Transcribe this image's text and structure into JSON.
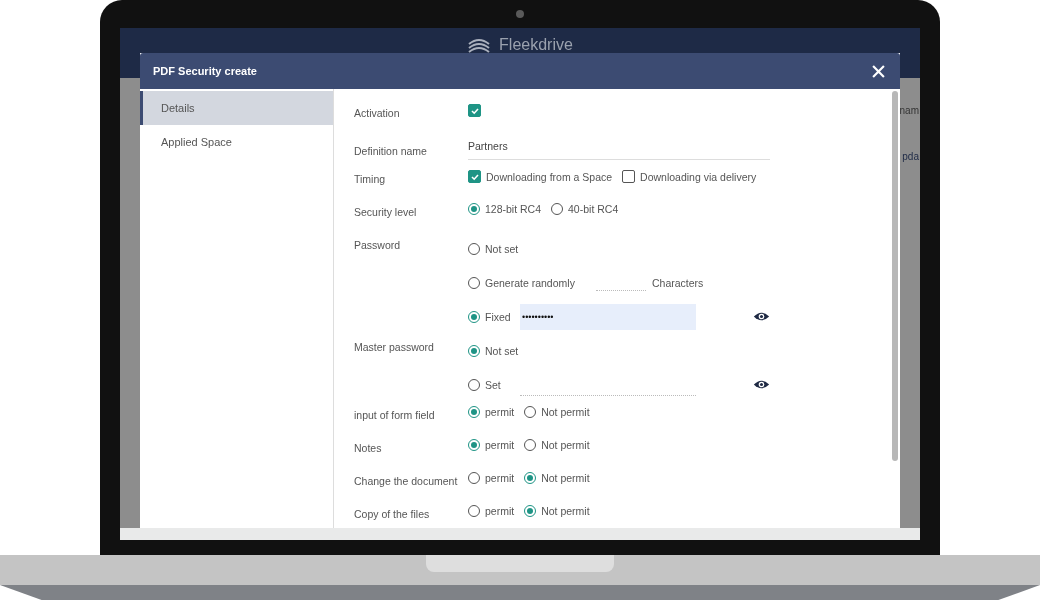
{
  "app": {
    "logo": "Fleekdrive",
    "background_fragments": [
      "nam",
      "pda"
    ]
  },
  "dialog": {
    "title": "PDF Security create",
    "tabs": [
      {
        "label": "Details",
        "selected": true
      },
      {
        "label": "Applied Space",
        "selected": false
      }
    ],
    "fields": [
      {
        "label": "Activation",
        "kind": "checkbox",
        "checked": true
      },
      {
        "label": "Definition name",
        "kind": "text",
        "value": "Partners"
      },
      {
        "label": "Timing",
        "kind": "checkboxes",
        "options": [
          {
            "label": "Downloading from a Space",
            "checked": true
          },
          {
            "label": "Downloading via delivery",
            "checked": false
          }
        ]
      },
      {
        "label": "Security level",
        "kind": "radios",
        "options": [
          {
            "label": "128-bit RC4",
            "selected": true
          },
          {
            "label": "40-bit RC4",
            "selected": false
          }
        ]
      },
      {
        "label": "Password",
        "kind": "stack",
        "options": [
          {
            "label": "Not set",
            "selected": false
          },
          {
            "label": "Generate randomly",
            "selected": false,
            "kind": "short_field",
            "suffix": "Characters"
          },
          {
            "label": "Fixed",
            "selected": true,
            "kind": "long_field",
            "value": "••••••••••",
            "reveal": true
          }
        ]
      },
      {
        "label": "Master password",
        "kind": "stack",
        "options": [
          {
            "label": "Not set",
            "selected": true
          },
          {
            "label": "Set",
            "selected": false,
            "kind": "long_field",
            "reveal": true
          }
        ]
      },
      {
        "label": "input of form field",
        "kind": "radios",
        "options": [
          {
            "label": "permit",
            "selected": true
          },
          {
            "label": "Not permit",
            "selected": false
          }
        ]
      },
      {
        "label": "Notes",
        "kind": "radios",
        "options": [
          {
            "label": "permit",
            "selected": true
          },
          {
            "label": "Not permit",
            "selected": false
          }
        ]
      },
      {
        "label": "Change the document",
        "kind": "radios",
        "options": [
          {
            "label": "permit",
            "selected": false
          },
          {
            "label": "Not permit",
            "selected": true
          }
        ]
      },
      {
        "label": "Copy of the files",
        "kind": "radios",
        "options": [
          {
            "label": "permit",
            "selected": false
          },
          {
            "label": "Not permit",
            "selected": true
          }
        ]
      }
    ]
  }
}
